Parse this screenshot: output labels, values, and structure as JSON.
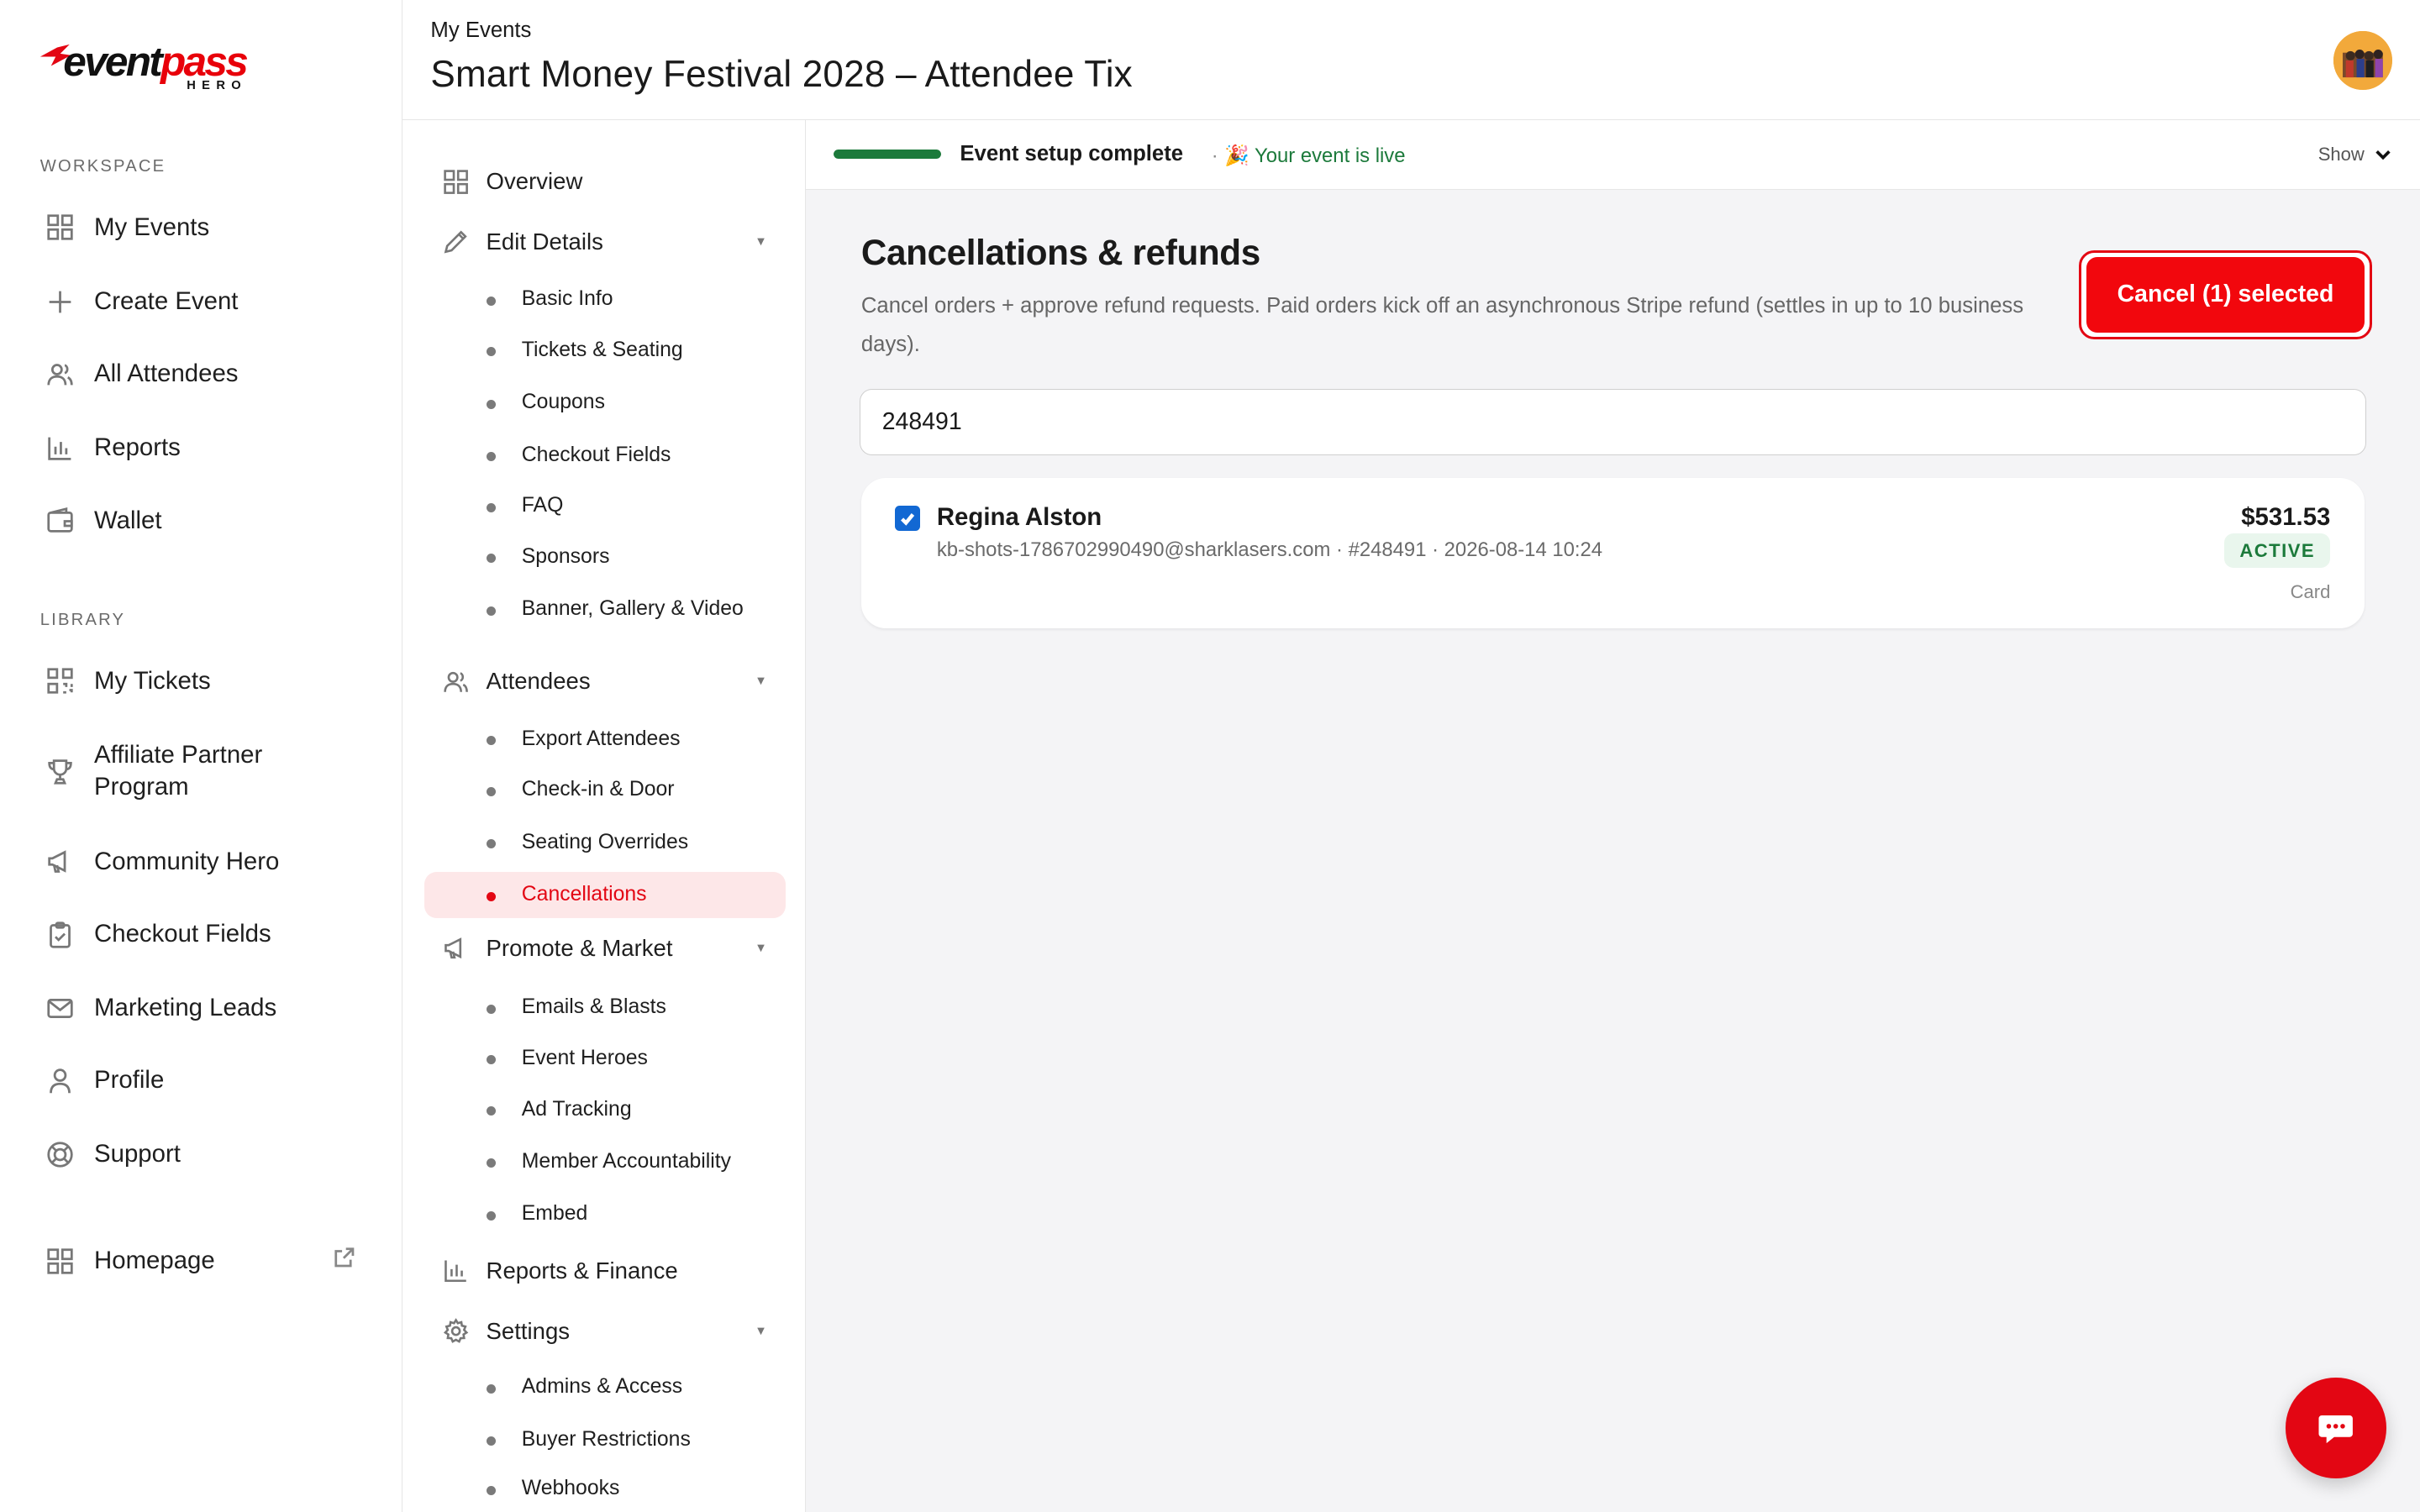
{
  "brand": {
    "logo_part1": "event",
    "logo_part2": "pass",
    "logo_sub": "HERO",
    "accent": "#e30613"
  },
  "sidebar": {
    "workspace_label": "WORKSPACE",
    "library_label": "LIBRARY",
    "workspace_items": [
      {
        "label": "My Events",
        "icon": "grid-icon"
      },
      {
        "label": "Create Event",
        "icon": "plus-icon"
      },
      {
        "label": "All Attendees",
        "icon": "users-icon"
      },
      {
        "label": "Reports",
        "icon": "bar-chart-icon"
      },
      {
        "label": "Wallet",
        "icon": "wallet-icon"
      }
    ],
    "library_items": [
      {
        "label": "My Tickets",
        "icon": "qr-icon"
      },
      {
        "label": "Affiliate Partner Program",
        "icon": "trophy-icon"
      },
      {
        "label": "Community Hero",
        "icon": "megaphone-icon"
      },
      {
        "label": "Checkout Fields",
        "icon": "clipboard-icon"
      },
      {
        "label": "Marketing Leads",
        "icon": "mail-icon"
      },
      {
        "label": "Profile",
        "icon": "user-icon"
      },
      {
        "label": "Support",
        "icon": "lifebuoy-icon"
      }
    ],
    "homepage_label": "Homepage"
  },
  "header": {
    "breadcrumb": "My Events",
    "title": "Smart Money Festival 2028 – Attendee Tix"
  },
  "subnav": {
    "overview": "Overview",
    "edit_details": "Edit Details",
    "edit_items": [
      "Basic Info",
      "Tickets & Seating",
      "Coupons",
      "Checkout Fields",
      "FAQ",
      "Sponsors",
      "Banner, Gallery & Video"
    ],
    "attendees": "Attendees",
    "attendee_items": [
      "Export Attendees",
      "Check-in & Door",
      "Seating Overrides",
      "Cancellations"
    ],
    "promote": "Promote & Market",
    "promote_items": [
      "Emails & Blasts",
      "Event Heroes",
      "Ad Tracking",
      "Member Accountability",
      "Embed"
    ],
    "reports": "Reports & Finance",
    "settings": "Settings",
    "settings_items": [
      "Admins & Access",
      "Buyer Restrictions",
      "Webhooks"
    ],
    "active": "Cancellations"
  },
  "setup": {
    "label": "Event setup complete",
    "live_text": "🎉 Your event is live",
    "show_label": "Show",
    "progress": 1.0
  },
  "cancellations": {
    "title": "Cancellations & refunds",
    "description": "Cancel orders + approve refund requests. Paid orders kick off an asynchronous Stripe refund (settles in up to 10 business days).",
    "cancel_button": "Cancel (1) selected",
    "search_value": "248491",
    "orders": [
      {
        "name": "Regina Alston",
        "meta": "kb-shots-1786702990490@sharklasers.com · #248491 · 2026-08-14 10:24",
        "amount": "$531.53",
        "status": "ACTIVE",
        "method": "Card",
        "checked": true
      }
    ]
  }
}
